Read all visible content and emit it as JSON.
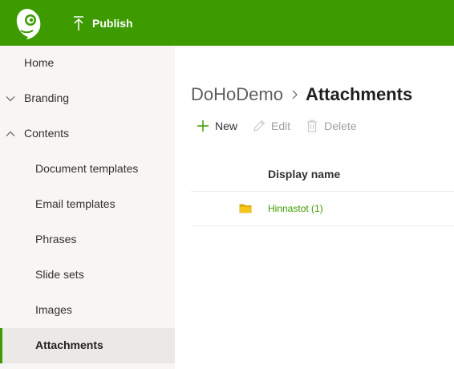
{
  "topbar": {
    "publish_label": "Publish",
    "colors": {
      "background": "#3d9b00",
      "text": "#ffffff"
    }
  },
  "sidebar": {
    "items": [
      {
        "label": "Home",
        "level": 0
      },
      {
        "label": "Branding",
        "level": 0,
        "chevron": "down"
      },
      {
        "label": "Contents",
        "level": 0,
        "chevron": "up"
      },
      {
        "label": "Document templates",
        "level": 1
      },
      {
        "label": "Email templates",
        "level": 1
      },
      {
        "label": "Phrases",
        "level": 1
      },
      {
        "label": "Slide sets",
        "level": 1
      },
      {
        "label": "Images",
        "level": 1
      },
      {
        "label": "Attachments",
        "level": 1,
        "active": true
      }
    ]
  },
  "main": {
    "breadcrumb": {
      "root": "DoHoDemo",
      "current": "Attachments"
    },
    "commands": {
      "new_label": "New",
      "edit_label": "Edit",
      "delete_label": "Delete"
    },
    "table": {
      "columns": [
        "Display name"
      ],
      "rows": [
        {
          "icon": "folder-icon",
          "name": "Hinnastot (1)"
        }
      ]
    }
  },
  "icons": {
    "logo": "chameleon-logo-icon",
    "publish": "upload-arrow-icon",
    "chevron_branding": "chevron-down-icon",
    "chevron_contents": "chevron-up-icon",
    "breadcrumb_separator": "chevron-right-icon",
    "new": "plus-icon",
    "edit": "pencil-icon",
    "delete": "trash-icon",
    "folder": "folder-icon"
  },
  "colors": {
    "accent": "#3d9b00",
    "sidebar_bg": "#f7f6f4",
    "active_bg": "#ebe9e6",
    "folder": "#e8b200"
  }
}
